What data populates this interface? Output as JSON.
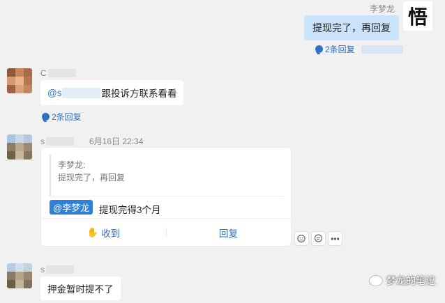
{
  "msg_self": {
    "sender": "李梦龙",
    "avatar_glyph": "悟",
    "text": "提现完了，再回复",
    "reply_count": "2条回复"
  },
  "msg_1": {
    "sender_initial": "C",
    "mention_prefix": "@s",
    "text": "跟投诉方联系看看",
    "reply_count": "2条回复"
  },
  "msg_2": {
    "sender_initial": "s",
    "timestamp": "6月16日 22:34",
    "quote_author": "李梦龙:",
    "quote_text": "提现完了，再回复",
    "mention": "@李梦龙",
    "text": "提现完得3个月",
    "btn_receive": "收到",
    "btn_reply": "回复"
  },
  "msg_3": {
    "sender_initial": "s",
    "text": "押金暂时提不了"
  },
  "watermark": "梦龙的笔记",
  "colors": {
    "accent": "#2f71c2",
    "bubble_self": "#c9e3fb",
    "background": "#f1f1f1"
  },
  "icons": [
    "reply-bubble-icon",
    "hand-icon",
    "emoji-add-icon",
    "comment-icon",
    "more-icon",
    "wechat-icon"
  ]
}
